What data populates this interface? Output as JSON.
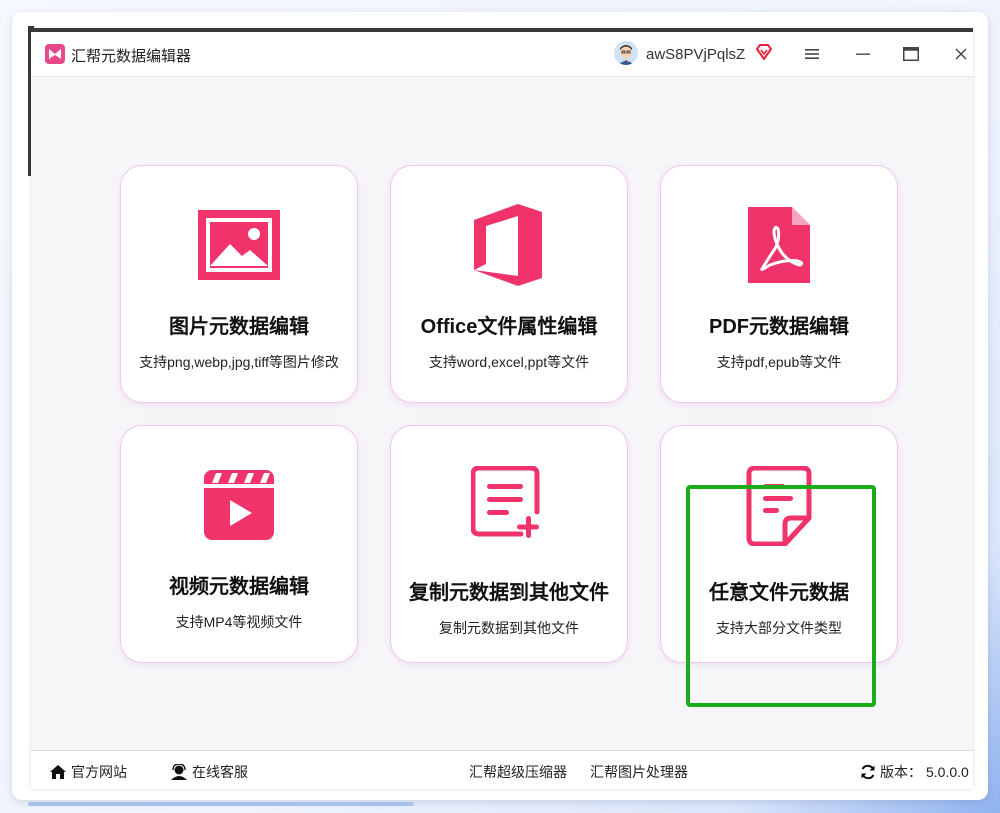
{
  "app": {
    "title": "汇帮元数据编辑器",
    "username": "awS8PVjPqlsZ"
  },
  "cards": [
    {
      "title": "图片元数据编辑",
      "desc": "支持png,webp,jpg,tiff等图片修改",
      "icon": "image-icon"
    },
    {
      "title": "Office文件属性编辑",
      "desc": "支持word,excel,ppt等文件",
      "icon": "office-icon"
    },
    {
      "title": "PDF元数据编辑",
      "desc": "支持pdf,epub等文件",
      "icon": "pdf-icon"
    },
    {
      "title": "视频元数据编辑",
      "desc": "支持MP4等视频文件",
      "icon": "video-icon"
    },
    {
      "title": "复制元数据到其他文件",
      "desc": "复制元数据到其他文件",
      "icon": "copy-document-icon"
    },
    {
      "title": "任意文件元数据",
      "desc": "支持大部分文件类型",
      "icon": "document-icon"
    }
  ],
  "footer": {
    "website": "官方网站",
    "support": "在线客服",
    "compressor": "汇帮超级压缩器",
    "image_processor": "汇帮图片处理器",
    "version_label": "版本：",
    "version": "5.0.0.0"
  },
  "colors": {
    "accent": "#f0336b",
    "highlight": "#1aad1a",
    "card_border": "#f0c8ee"
  }
}
